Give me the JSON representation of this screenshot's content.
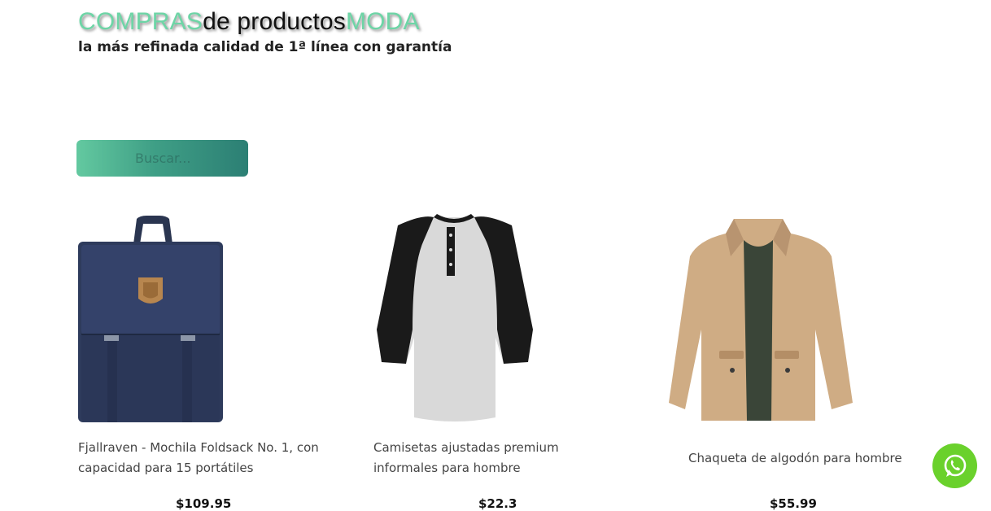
{
  "header": {
    "brand_part1": "COMPRAS",
    "brand_part2": "de productos",
    "brand_part3": "MODA",
    "tagline": "la más refinada calidad de 1ª línea con garantía"
  },
  "search": {
    "placeholder": "Buscar..."
  },
  "products": [
    {
      "name": "Fjallraven - Mochila Foldsack No. 1, con capacidad para 15 portátiles",
      "price": "$109.95"
    },
    {
      "name": "Camisetas ajustadas premium informales para hombre",
      "price": "$22.3"
    },
    {
      "name": "Chaqueta de algodón para hombre",
      "price": "$55.99"
    }
  ],
  "whatsapp": {
    "icon": "whatsapp-icon"
  },
  "colors": {
    "accent": "#6dd5a6",
    "search_start": "#63c9a0",
    "search_end": "#2c7f74",
    "whatsapp": "#6ad12c"
  }
}
